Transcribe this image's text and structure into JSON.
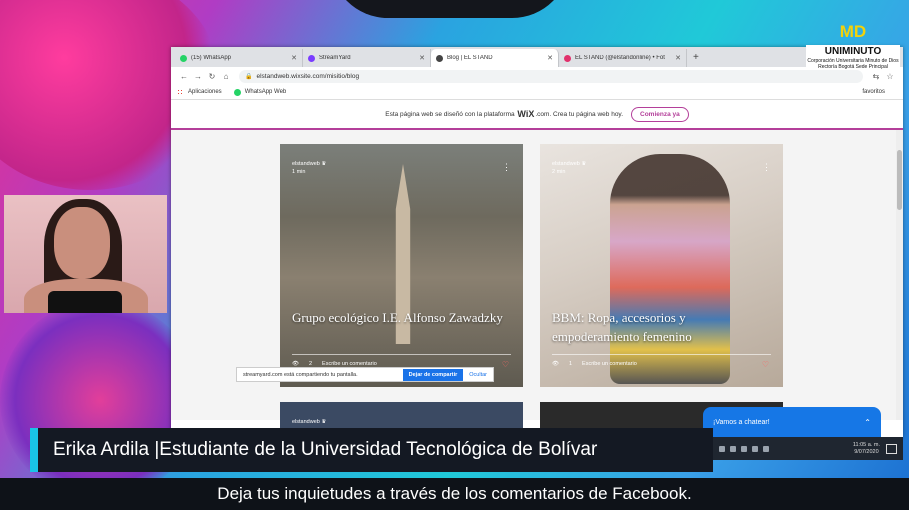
{
  "browser": {
    "tabs": [
      {
        "label": "(15) WhatsApp",
        "color": "#25d366"
      },
      {
        "label": "StreamYard",
        "color": "#7a3cff"
      },
      {
        "label": "Blog | EL STAND",
        "color": "#444444"
      },
      {
        "label": "EL STAND (@elstandonline) • Fot",
        "color": "#e1306c"
      }
    ],
    "new_tab": "+",
    "url": "elstandweb.wixsite.com/misitio/blog",
    "bookmarks": [
      "Aplicaciones",
      "WhatsApp Web"
    ],
    "other_bookmarks": "favoritos"
  },
  "wix_banner": {
    "text_before": "Esta página web se diseñó con la plataforma",
    "brand": "WiX",
    "text_after": ".com. Crea tu página web hoy.",
    "cta": "Comienza ya"
  },
  "posts": [
    {
      "author": "elstandweb",
      "time": "1 min",
      "title": "Grupo ecológico I.E. Alfonso Zawadzky",
      "views": "2",
      "comment_label": "Escribe un comentario"
    },
    {
      "author": "elstandweb",
      "time": "2 min",
      "title": "BBM: Ropa, accesorios y empoderamiento femenino",
      "views": "1",
      "comment_label": "Escribe un comentario"
    },
    {
      "author": "elstandweb"
    }
  ],
  "share_bar": {
    "text": "streamyard.com está compartiendo tu pantalla.",
    "stop": "Dejar de compartir",
    "hide": "Ocultar"
  },
  "chat": {
    "label": "¡Vamos a chatear!"
  },
  "taskbar": {
    "time": "11:05 a. m.",
    "date": "9/07/2020"
  },
  "logo": {
    "md": "MD",
    "uni": "UNIMINUTO",
    "sub": "Corporación Universitaria Minuto de Dios",
    "sede": "Rectoría Bogotá Sede Principal"
  },
  "overlay": {
    "name": "Erika Ardila |Estudiante de la Universidad Tecnológica de Bolívar",
    "ticker": "Deja tus inquietudes a través de los comentarios de Facebook."
  }
}
